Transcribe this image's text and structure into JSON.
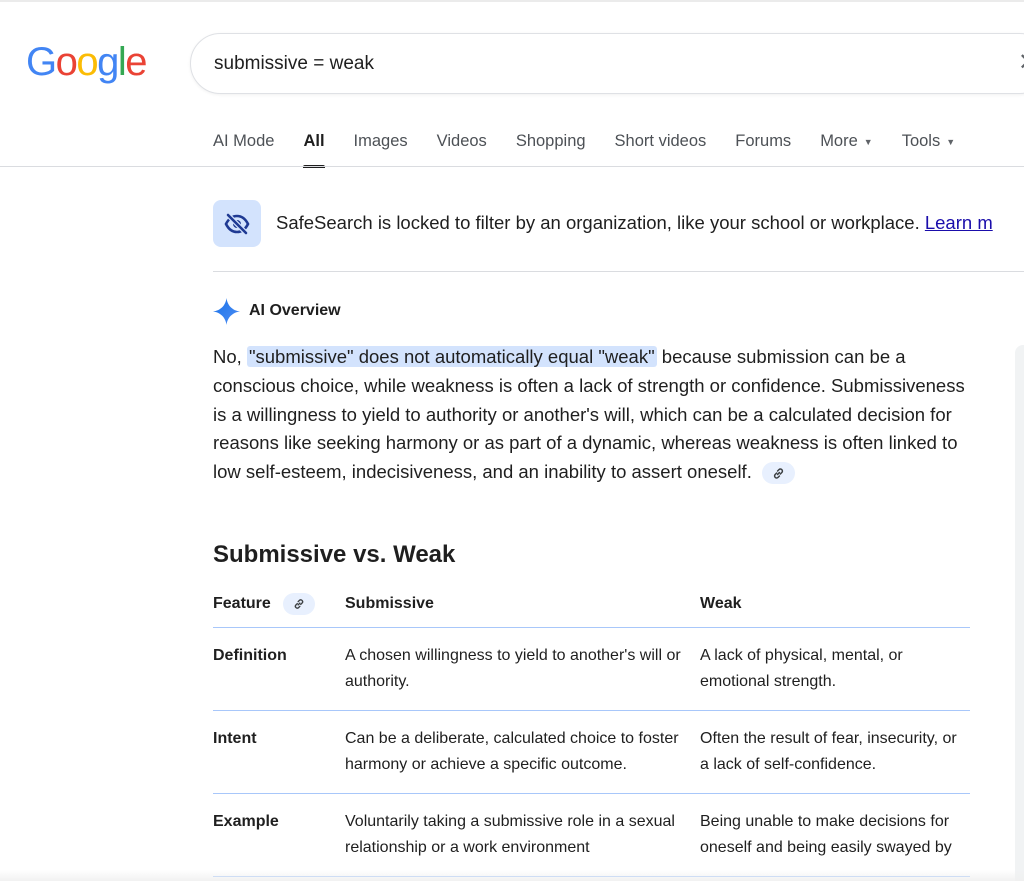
{
  "logo": {
    "letters": [
      "G",
      "o",
      "o",
      "g",
      "l",
      "e"
    ],
    "colors": [
      "#4285F4",
      "#EA4335",
      "#FBBC05",
      "#4285F4",
      "#34A853",
      "#EA4335"
    ]
  },
  "search": {
    "query": "submissive = weak",
    "clear_icon": "close-icon"
  },
  "tabs": [
    {
      "label": "AI Mode"
    },
    {
      "label": "All",
      "active": true
    },
    {
      "label": "Images"
    },
    {
      "label": "Videos"
    },
    {
      "label": "Shopping"
    },
    {
      "label": "Short videos"
    },
    {
      "label": "Forums"
    },
    {
      "label": "More"
    },
    {
      "label": "Tools"
    }
  ],
  "safesearch": {
    "icon": "eye-off-icon",
    "text": "SafeSearch is locked to filter by an organization, like your school or workplace.",
    "link": "Learn m"
  },
  "ai_overview": {
    "title": "AI Overview",
    "icon": "sparkle-icon",
    "intro": "No, ",
    "highlight": "\"submissive\" does not automatically equal \"weak\"",
    "body": " because submission can be a conscious choice, while weakness is often a lack of strength or confidence. Submissiveness is a willingness to yield to authority or another's will, which can be a calculated decision for reasons like seeking harmony or as part of a dynamic, whereas weakness is often linked to low self-esteem, indecisiveness, and an inability to assert oneself.",
    "cite_icon": "link-icon"
  },
  "table": {
    "title": "Submissive vs. Weak",
    "headers": [
      "Feature",
      "Submissive",
      "Weak"
    ],
    "rows": [
      {
        "feature": "Definition",
        "submissive": "A chosen willingness to yield to another's will or authority.",
        "weak": "A lack of physical, mental, or emotional strength."
      },
      {
        "feature": "Intent",
        "submissive": "Can be a deliberate, calculated choice to foster harmony or achieve a specific outcome.",
        "weak": "Often the result of fear, insecurity, or a lack of self-confidence."
      },
      {
        "feature": "Example",
        "submissive": "Voluntarily taking a submissive role in a sexual relationship or a work environment",
        "weak": "Being unable to make decisions for oneself and being easily swayed by"
      }
    ]
  },
  "colors": {
    "accent": "#1a73e8",
    "highlight": "#d3e3fd",
    "link": "#1a0dab",
    "table_rule": "#a8c7fa"
  }
}
